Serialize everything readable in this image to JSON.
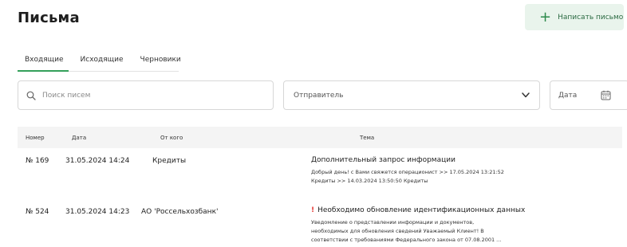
{
  "header": {
    "title": "Письма",
    "compose_label": "Написать письмо",
    "compose_icon": "plus-icon",
    "accent_color": "#34a05a"
  },
  "tabs": [
    {
      "label": "Входящие",
      "active": true
    },
    {
      "label": "Исходящие",
      "active": false
    },
    {
      "label": "Черновики",
      "active": false
    }
  ],
  "filters": {
    "search_placeholder": "Поиск писем",
    "sender_placeholder": "Отправитель",
    "date_placeholder": "Дата"
  },
  "table": {
    "columns": {
      "number": "Номер",
      "date": "Дата",
      "from": "От кого",
      "subject": "Тема"
    },
    "rows": [
      {
        "number": "№ 169",
        "date": "31.05.2024 14:24",
        "from": "Кредиты",
        "subject": "Дополнительный запрос информации",
        "important": false,
        "preview": [
          "Добрый день! с Вами свяжется операционист >> 17.05.2024 13:21:52",
          "Кредиты >> 14.03.2024 13:50:50 Кредиты"
        ]
      },
      {
        "number": "№ 524",
        "date": "31.05.2024 14:23",
        "from": "АО 'Россельхозбанк'",
        "subject": "Необходимо обновление идентификационных данных",
        "important": true,
        "important_mark": "!",
        "preview": [
          "Уведомление о представлении информации и документов,",
          "необходимых для обновления сведений Уважаемый Клиент! В",
          "соответствии с требованиями Федерального закона от 07.08.2001 ..."
        ]
      }
    ]
  }
}
